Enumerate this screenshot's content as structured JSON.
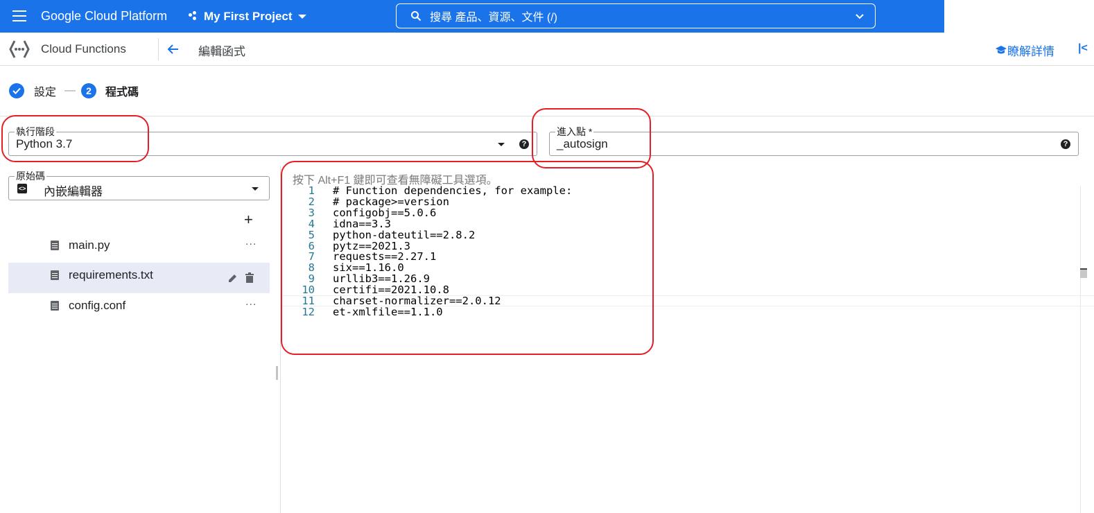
{
  "header": {
    "brand": "Google Cloud Platform",
    "project": "My First Project",
    "search_text": "搜尋  產品、資源、文件 (/)"
  },
  "subheader": {
    "product": "Cloud Functions",
    "page_title": "編輯函式",
    "learn_more": "瞭解詳情",
    "collapse": "|<"
  },
  "steps": {
    "step1_label": "設定",
    "separator": "—",
    "step2_number": "2",
    "step2_label": "程式碼"
  },
  "runtime": {
    "label": "執行階段",
    "value": "Python 3.7"
  },
  "entry_point": {
    "label": "進入點 *",
    "value": "_autosign"
  },
  "source": {
    "label": "原始碼",
    "value": "內嵌編輯器"
  },
  "add_file": "+",
  "files": [
    {
      "name": "main.py",
      "selected": false
    },
    {
      "name": "requirements.txt",
      "selected": true
    },
    {
      "name": "config.conf",
      "selected": false
    }
  ],
  "more_label": "...",
  "editor": {
    "hint": "按下 Alt+F1 鍵即可查看無障礙工具選項。",
    "lines": [
      {
        "n": "1",
        "text": "# Function dependencies, for example:"
      },
      {
        "n": "2",
        "text": "# package>=version"
      },
      {
        "n": "3",
        "text": "configobj==5.0.6"
      },
      {
        "n": "4",
        "text": "idna==3.3"
      },
      {
        "n": "5",
        "text": "python-dateutil==2.8.2"
      },
      {
        "n": "6",
        "text": "pytz==2021.3"
      },
      {
        "n": "7",
        "text": "requests==2.27.1"
      },
      {
        "n": "8",
        "text": "six==1.16.0"
      },
      {
        "n": "9",
        "text": "urllib3==1.26.9"
      },
      {
        "n": "10",
        "text": "certifi==2021.10.8"
      },
      {
        "n": "11",
        "text": "charset-normalizer==2.0.12"
      },
      {
        "n": "12",
        "text": "et-xmlfile==1.1.0"
      }
    ]
  },
  "colors": {
    "primary": "#1a73e8",
    "annotation": "#e31e24",
    "selected_row": "#e8eaf6"
  },
  "icons": [
    "menu-icon",
    "project-icon",
    "search-icon",
    "chevron-down-icon",
    "cloud-functions-icon",
    "back-arrow-icon",
    "school-icon",
    "check-icon",
    "help-icon",
    "file-icon",
    "edit-icon",
    "delete-icon",
    "code-icon"
  ]
}
